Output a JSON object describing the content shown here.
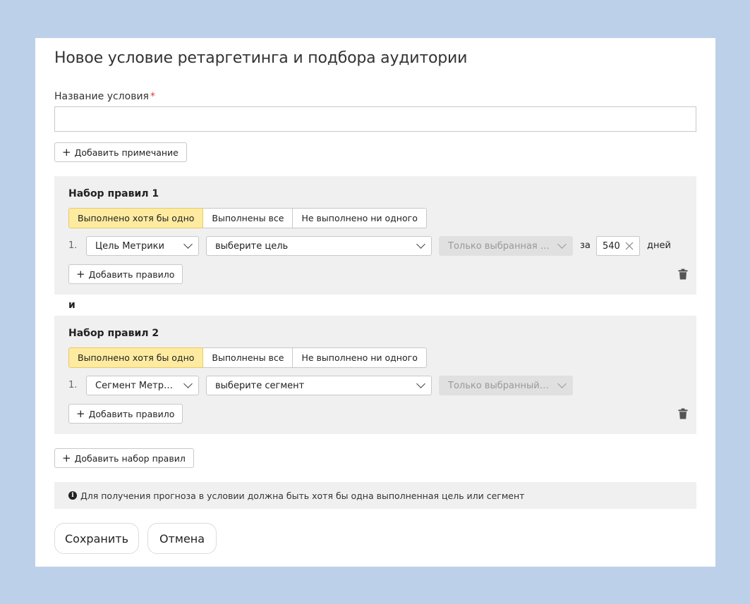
{
  "dialog": {
    "title": "Новое условие ретаргетинга и подбора аудитории",
    "name_label": "Название условия",
    "required_mark": "*",
    "name_value": "",
    "add_note_label": "Добавить примечание"
  },
  "rulesets": [
    {
      "title": "Набор правил 1",
      "modes": [
        "Выполнено хотя бы одно",
        "Выполнены все",
        "Не выполнено ни одного"
      ],
      "active_mode": "Выполнено хотя бы одно",
      "rule": {
        "number": "1.",
        "type": "Цель Метрики",
        "target_placeholder": "выберите цель",
        "scope": "Только выбранная цель",
        "period_prefix": "за",
        "period_value": "540",
        "period_suffix": "дней"
      },
      "add_rule_label": "Добавить правило"
    },
    {
      "title": "Набор правил 2",
      "modes": [
        "Выполнено хотя бы одно",
        "Выполнены все",
        "Не выполнено ни одного"
      ],
      "active_mode": "Выполнено хотя бы одно",
      "rule": {
        "number": "1.",
        "type": "Сегмент Метрики",
        "target_placeholder": "выберите сегмент",
        "scope": "Только выбранный сег..."
      },
      "add_rule_label": "Добавить правило"
    }
  ],
  "and_label": "и",
  "add_ruleset_label": "Добавить набор правил",
  "info_text": "Для получения прогноза в условии должна быть хотя бы одна выполненная цель или сегмент",
  "actions": {
    "save": "Сохранить",
    "cancel": "Отмена"
  },
  "colors": {
    "background": "#bdd0ea",
    "active_segment": "#ffeba0",
    "panel": "#f0f0f0",
    "required": "#e53935"
  },
  "icons": {
    "plus": "plus-icon",
    "chevron": "chevron-down-icon",
    "clear": "close-icon",
    "delete": "trash-icon",
    "info": "info-icon"
  }
}
